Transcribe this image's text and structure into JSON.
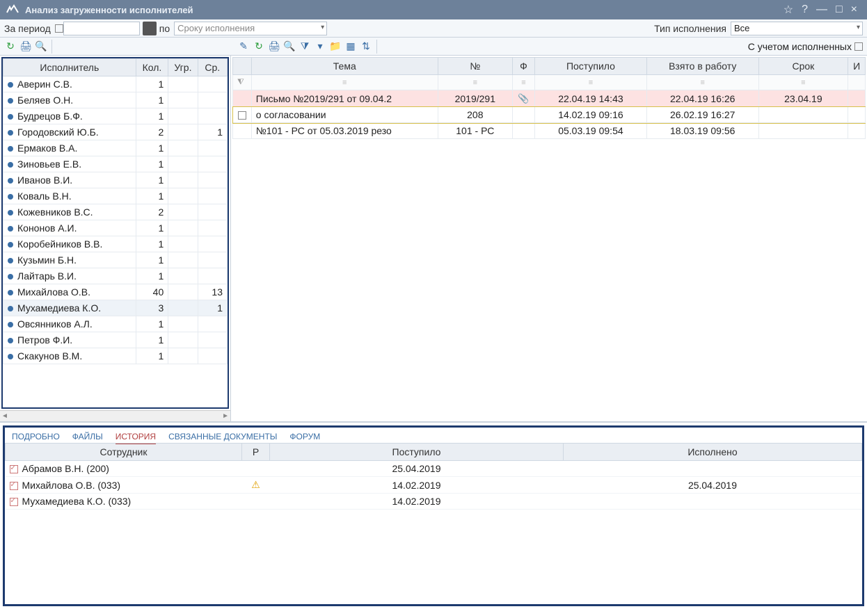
{
  "window": {
    "title": "Анализ загруженности исполнителей"
  },
  "toolbar": {
    "period_label": "За период",
    "period_from": "",
    "period_to": "",
    "po_label": "по",
    "deadline_combo": "Сроку исполнения",
    "type_label": "Тип исполнения",
    "type_value": "Все",
    "with_completed": "С учетом исполненных"
  },
  "left_grid": {
    "headers": {
      "name": "Исполнитель",
      "cnt": "Кол.",
      "ugr": "Угр.",
      "sr": "Ср."
    },
    "rows": [
      {
        "name": "Аверин С.В.",
        "cnt": "1",
        "ugr": "",
        "sr": ""
      },
      {
        "name": "Беляев О.Н.",
        "cnt": "1",
        "ugr": "",
        "sr": ""
      },
      {
        "name": "Будрецов Б.Ф.",
        "cnt": "1",
        "ugr": "",
        "sr": ""
      },
      {
        "name": "Городовский Ю.Б.",
        "cnt": "2",
        "ugr": "",
        "sr": "1"
      },
      {
        "name": "Ермаков В.А.",
        "cnt": "1",
        "ugr": "",
        "sr": ""
      },
      {
        "name": "Зиновьев Е.В.",
        "cnt": "1",
        "ugr": "",
        "sr": ""
      },
      {
        "name": "Иванов В.И.",
        "cnt": "1",
        "ugr": "",
        "sr": ""
      },
      {
        "name": "Коваль В.Н.",
        "cnt": "1",
        "ugr": "",
        "sr": ""
      },
      {
        "name": "Кожевников В.С.",
        "cnt": "2",
        "ugr": "",
        "sr": ""
      },
      {
        "name": "Кононов А.И.",
        "cnt": "1",
        "ugr": "",
        "sr": ""
      },
      {
        "name": "Коробейников В.В.",
        "cnt": "1",
        "ugr": "",
        "sr": ""
      },
      {
        "name": "Кузьмин Б.Н.",
        "cnt": "1",
        "ugr": "",
        "sr": ""
      },
      {
        "name": "Лайтарь В.И.",
        "cnt": "1",
        "ugr": "",
        "sr": ""
      },
      {
        "name": "Михайлова О.В.",
        "cnt": "40",
        "ugr": "",
        "sr": "13"
      },
      {
        "name": "Мухамедиева К.О.",
        "cnt": "3",
        "ugr": "",
        "sr": "1",
        "selected": true
      },
      {
        "name": "Овсянников А.Л.",
        "cnt": "1",
        "ugr": "",
        "sr": ""
      },
      {
        "name": "Петров Ф.И.",
        "cnt": "1",
        "ugr": "",
        "sr": ""
      },
      {
        "name": "Скакунов В.М.",
        "cnt": "1",
        "ugr": "",
        "sr": ""
      }
    ]
  },
  "right_grid": {
    "headers": {
      "theme": "Тема",
      "no": "№",
      "f": "Ф",
      "received": "Поступило",
      "taken": "Взято в работу",
      "due": "Срок",
      "i": "И"
    },
    "rows": [
      {
        "theme": "Письмо №2019/291 от 09.04.2",
        "no": "2019/291",
        "attach": true,
        "received": "22.04.19 14:43",
        "taken": "22.04.19 16:26",
        "due": "23.04.19",
        "style": "pink"
      },
      {
        "theme": "о согласовании",
        "no": "208",
        "attach": false,
        "received": "14.02.19 09:16",
        "taken": "26.02.19 16:27",
        "due": "",
        "style": "yel",
        "checkbox": true
      },
      {
        "theme": "№101 - РС от 05.03.2019 резо",
        "no": "101 - РС",
        "attach": false,
        "received": "05.03.19 09:54",
        "taken": "18.03.19 09:56",
        "due": "",
        "style": ""
      }
    ]
  },
  "tabs": {
    "items": [
      "ПОДРОБНО",
      "ФАЙЛЫ",
      "ИСТОРИЯ",
      "СВЯЗАННЫЕ ДОКУМЕНТЫ",
      "ФОРУМ"
    ],
    "active": 2
  },
  "history": {
    "headers": {
      "emp": "Сотрудник",
      "r": "Р",
      "received": "Поступило",
      "done": "Исполнено"
    },
    "rows": [
      {
        "emp": "Абрамов В.Н. (200)",
        "warn": false,
        "received": "25.04.2019",
        "done": ""
      },
      {
        "emp": "Михайлова О.В. (033)",
        "warn": true,
        "received": "14.02.2019",
        "done": "25.04.2019"
      },
      {
        "emp": "Мухамедиева К.О. (033)",
        "warn": false,
        "received": "14.02.2019",
        "done": ""
      }
    ]
  }
}
